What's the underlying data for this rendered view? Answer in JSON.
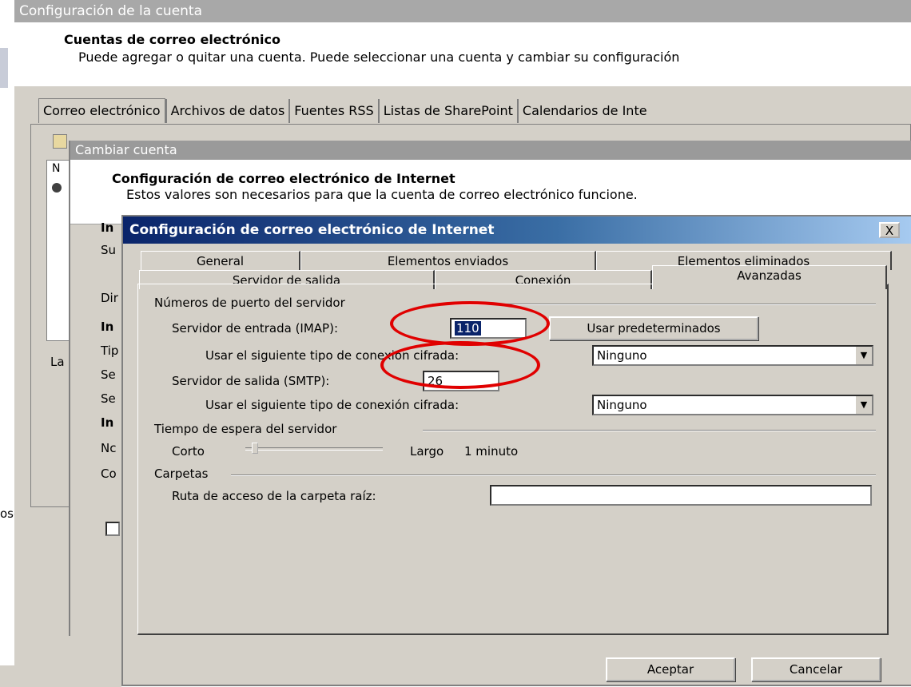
{
  "account_window": {
    "title": "Configuración de la cuenta",
    "heading": "Cuentas de correo electrónico",
    "description": "Puede agregar o quitar una cuenta. Puede seleccionar una cuenta y cambiar su configuración",
    "tabs": [
      "Correo electrónico",
      "Archivos de datos",
      "Fuentes RSS",
      "Listas de SharePoint",
      "Calendarios de Inte"
    ],
    "left_fragments": [
      "La",
      "osoft"
    ],
    "list_header_fragment": "N"
  },
  "change_window": {
    "title": "Cambiar cuenta",
    "heading": "Configuración de correo electrónico de Internet",
    "description": "Estos valores son necesarios para que la cuenta de correo electrónico funcione.",
    "left_labels": [
      "In",
      "Su",
      "Dir",
      "In",
      "Tip",
      "Se",
      "Se",
      "In",
      "Nc",
      "Co"
    ]
  },
  "dialog": {
    "title": "Configuración de correo electrónico de Internet",
    "close_label": "X",
    "tabs_row1": [
      "General",
      "Elementos enviados",
      "Elementos eliminados"
    ],
    "tabs_row2": [
      "Servidor de salida",
      "Conexión",
      "Avanzadas"
    ],
    "active_tab": "Avanzadas",
    "ports_group": "Números de puerto del servidor",
    "incoming_label": "Servidor de entrada (IMAP):",
    "incoming_value": "110",
    "use_defaults_button": "Usar predeterminados",
    "encrypt_label_1": "Usar el siguiente tipo de conexión cifrada:",
    "encrypt_value_1": "Ninguno",
    "outgoing_label": "Servidor de salida (SMTP):",
    "outgoing_value": "26",
    "encrypt_label_2": "Usar el siguiente tipo de conexión cifrada:",
    "encrypt_value_2": "Ninguno",
    "timeout_group": "Tiempo de espera del servidor",
    "timeout_short": "Corto",
    "timeout_long": "Largo",
    "timeout_value": "1 minuto",
    "timeout_level": 0.05,
    "folders_group": "Carpetas",
    "root_folder_label": "Ruta de acceso de la carpeta raíz:",
    "root_folder_value": "",
    "ok_button": "Aceptar",
    "cancel_button": "Cancelar"
  },
  "colors": {
    "annotation": "#e00000",
    "title_active": "#0a246a",
    "face": "#d4d0c8"
  }
}
